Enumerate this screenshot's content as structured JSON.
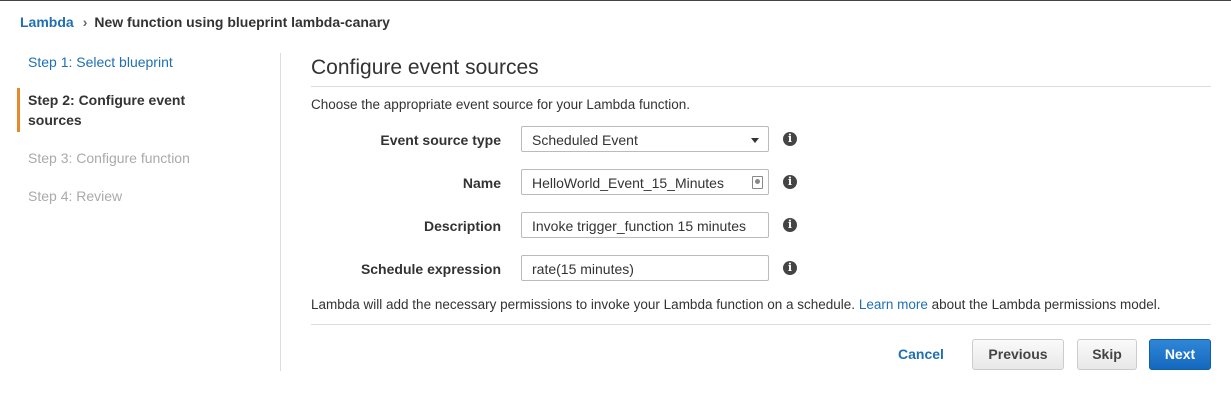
{
  "breadcrumb": {
    "root": "Lambda",
    "separator": "›",
    "current": "New function using blueprint lambda-canary"
  },
  "steps": [
    {
      "label": "Step 1: Select blueprint",
      "state": "link"
    },
    {
      "label": "Step 2: Configure event sources",
      "state": "active"
    },
    {
      "label": "Step 3: Configure function",
      "state": "disabled"
    },
    {
      "label": "Step 4: Review",
      "state": "disabled"
    }
  ],
  "main": {
    "title": "Configure event sources",
    "subtitle": "Choose the appropriate event source for your Lambda function."
  },
  "form": {
    "event_source_type": {
      "label": "Event source type",
      "value": "Scheduled Event"
    },
    "name": {
      "label": "Name",
      "value": "HelloWorld_Event_15_Minutes"
    },
    "description": {
      "label": "Description",
      "value": "Invoke trigger_function 15 minutes"
    },
    "schedule_expression": {
      "label": "Schedule expression",
      "value": "rate(15 minutes)"
    },
    "info_icon_glyph": "i"
  },
  "note": {
    "before": "Lambda will add the necessary permissions to invoke your Lambda function on a schedule. ",
    "link": "Learn more",
    "after": " about the Lambda permissions model."
  },
  "buttons": {
    "cancel": "Cancel",
    "previous": "Previous",
    "skip": "Skip",
    "next": "Next"
  },
  "colors": {
    "link": "#1f6fb2",
    "active_step_marker": "#e48a2c",
    "primary_button": "#1a72c7"
  }
}
